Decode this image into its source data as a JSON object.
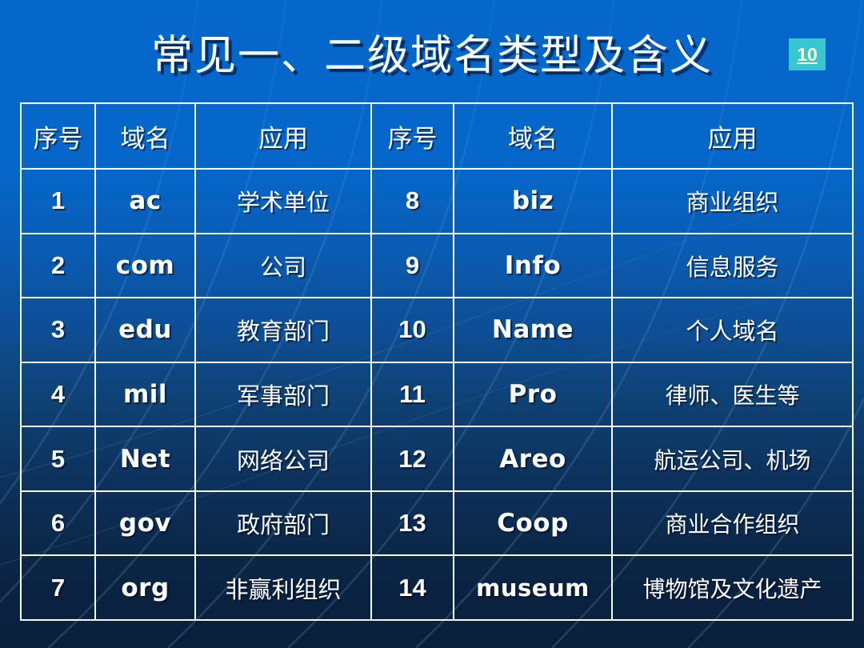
{
  "slide": {
    "title": "常见一、二级域名类型及含义",
    "badge_number": "10",
    "badge_color": "#38c6d2",
    "background_top_color": "#0567ca",
    "background_bottom_color": "#09203c",
    "text_color": "#ffffff",
    "border_color": "#f4fbff"
  },
  "table": {
    "headers_left": {
      "index": "序号",
      "domain": "域名",
      "application": "应用"
    },
    "headers_right": {
      "index": "序号",
      "domain": "域名",
      "application": "应用"
    },
    "rows": [
      {
        "left_no": "1",
        "left_domain": "ac",
        "left_app": "学术单位",
        "right_no": "8",
        "right_domain": "biz",
        "right_app": "商业组织"
      },
      {
        "left_no": "2",
        "left_domain": "com",
        "left_app": "公司",
        "right_no": "9",
        "right_domain": "Info",
        "right_app": "信息服务"
      },
      {
        "left_no": "3",
        "left_domain": "edu",
        "left_app": "教育部门",
        "right_no": "10",
        "right_domain": "Name",
        "right_app": "个人域名"
      },
      {
        "left_no": "4",
        "left_domain": "mil",
        "left_app": "军事部门",
        "right_no": "11",
        "right_domain": "Pro",
        "right_app": "律师、医生等"
      },
      {
        "left_no": "5",
        "left_domain": "Net",
        "left_app": "网络公司",
        "right_no": "12",
        "right_domain": "Areo",
        "right_app": "航运公司、机场"
      },
      {
        "left_no": "6",
        "left_domain": "gov",
        "left_app": "政府部门",
        "right_no": "13",
        "right_domain": "Coop",
        "right_app": "商业合作组织"
      },
      {
        "left_no": "7",
        "left_domain": "org",
        "left_app": "非赢利组织",
        "right_no": "14",
        "right_domain": "museum",
        "right_app": "博物馆及文化遗产"
      }
    ]
  }
}
